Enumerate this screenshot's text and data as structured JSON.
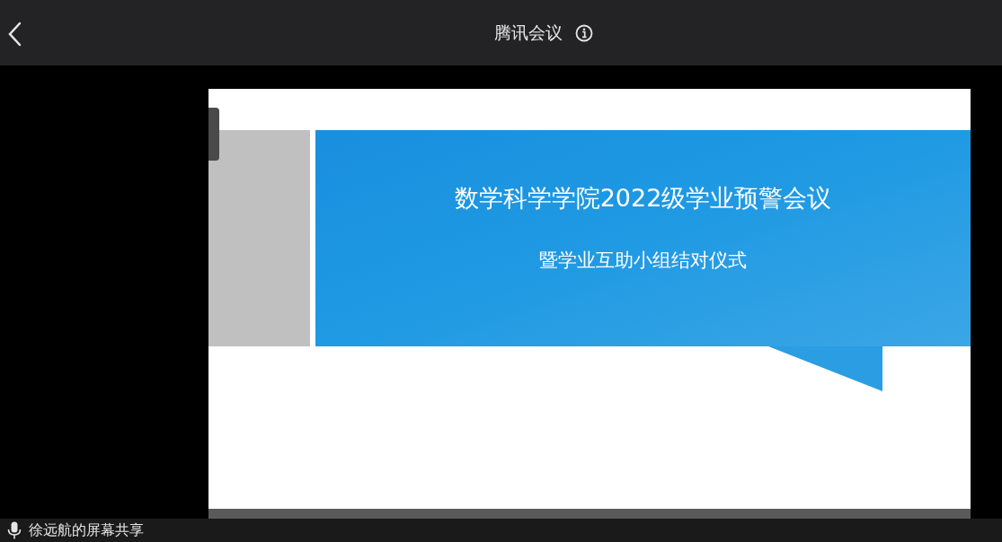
{
  "header": {
    "title": "腾讯会议"
  },
  "shared_slide": {
    "title": "数学科学学院2022级学业预警会议",
    "subtitle": "暨学业互助小组结对仪式"
  },
  "status_bar": {
    "text": "徐远航的屏幕共享"
  }
}
